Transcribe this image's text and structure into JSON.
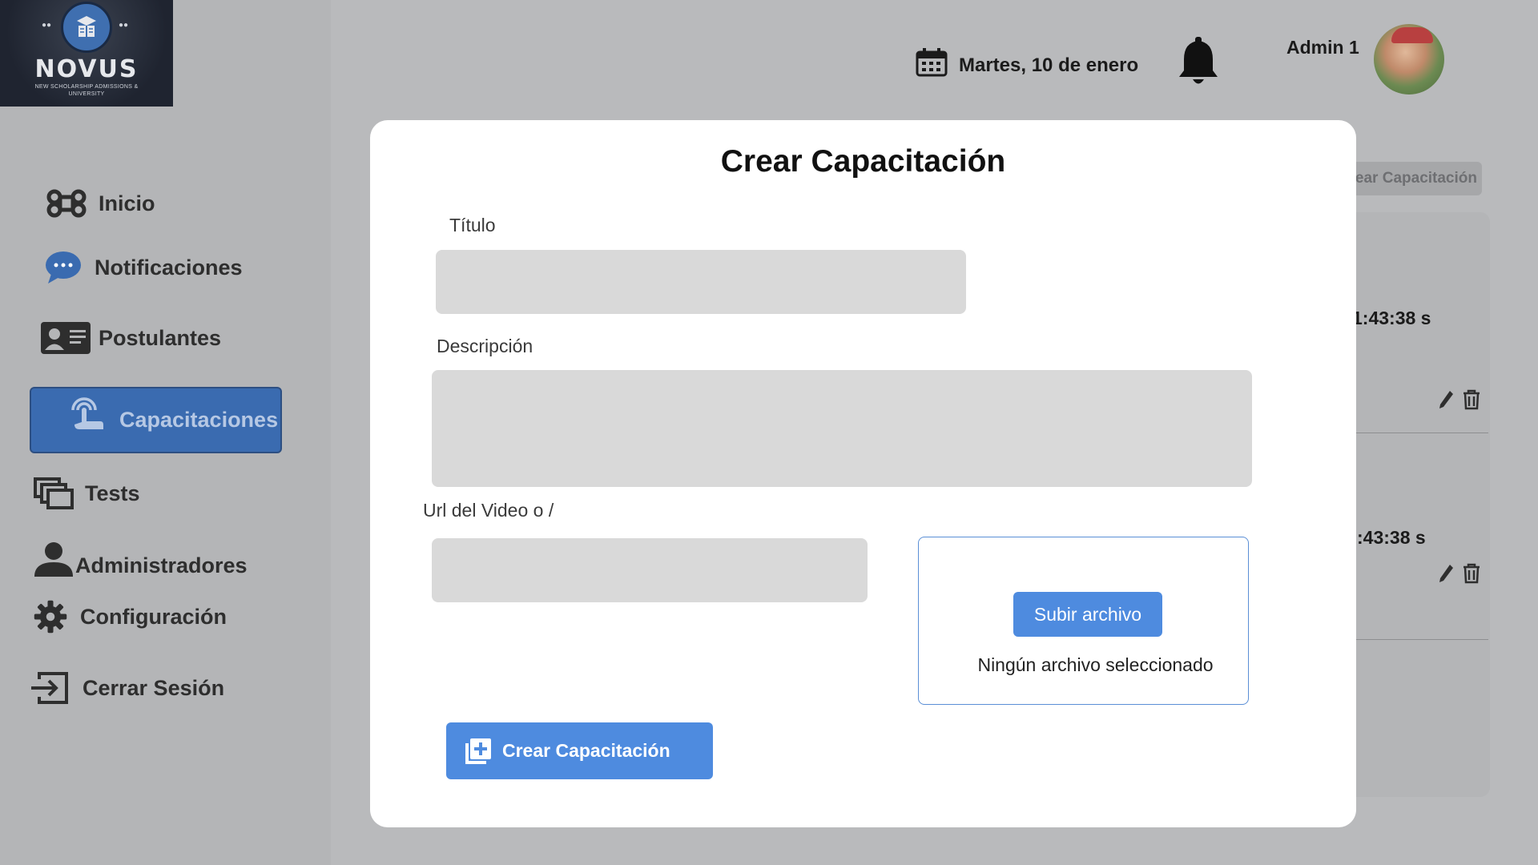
{
  "brand": {
    "name": "NOVUS",
    "tagline": "NEW SCHOLARSHIP ADMISSIONS & UNIVERSITY"
  },
  "sidebar": {
    "items": [
      {
        "label": "Inicio",
        "icon": "command-icon"
      },
      {
        "label": "Notificaciones",
        "icon": "chat-bubble-icon"
      },
      {
        "label": "Postulantes",
        "icon": "id-card-icon"
      },
      {
        "label": "Capacitaciones",
        "icon": "touch-hand-icon",
        "active": true
      },
      {
        "label": "Tests",
        "icon": "copy-windows-icon"
      },
      {
        "label": "Administradores",
        "icon": "user-icon"
      },
      {
        "label": "Configuración",
        "icon": "gear-icon"
      },
      {
        "label": "Cerrar Sesión",
        "icon": "logout-icon"
      }
    ]
  },
  "header": {
    "date": "Martes, 10 de enero",
    "user_name": "Admin 1"
  },
  "background": {
    "create_button_partial": "ear Capacitación",
    "row1_time": "1:43:38 s",
    "row2_time": ":43:38 s",
    "row1_mark": ":"
  },
  "modal": {
    "title": "Crear Capacitación",
    "titulo_label": "Título",
    "titulo_value": "",
    "descripcion_label": "Descripción",
    "descripcion_value": "",
    "url_label": "Url del Video o /",
    "url_value": "",
    "upload_button": "Subir archivo",
    "upload_status": "Ningún archivo seleccionado",
    "submit_label": "Crear Capacitación"
  },
  "colors": {
    "accent": "#4e8bdf",
    "active_nav": "#3a6bb0",
    "overlay_bg": "#b9babc"
  }
}
